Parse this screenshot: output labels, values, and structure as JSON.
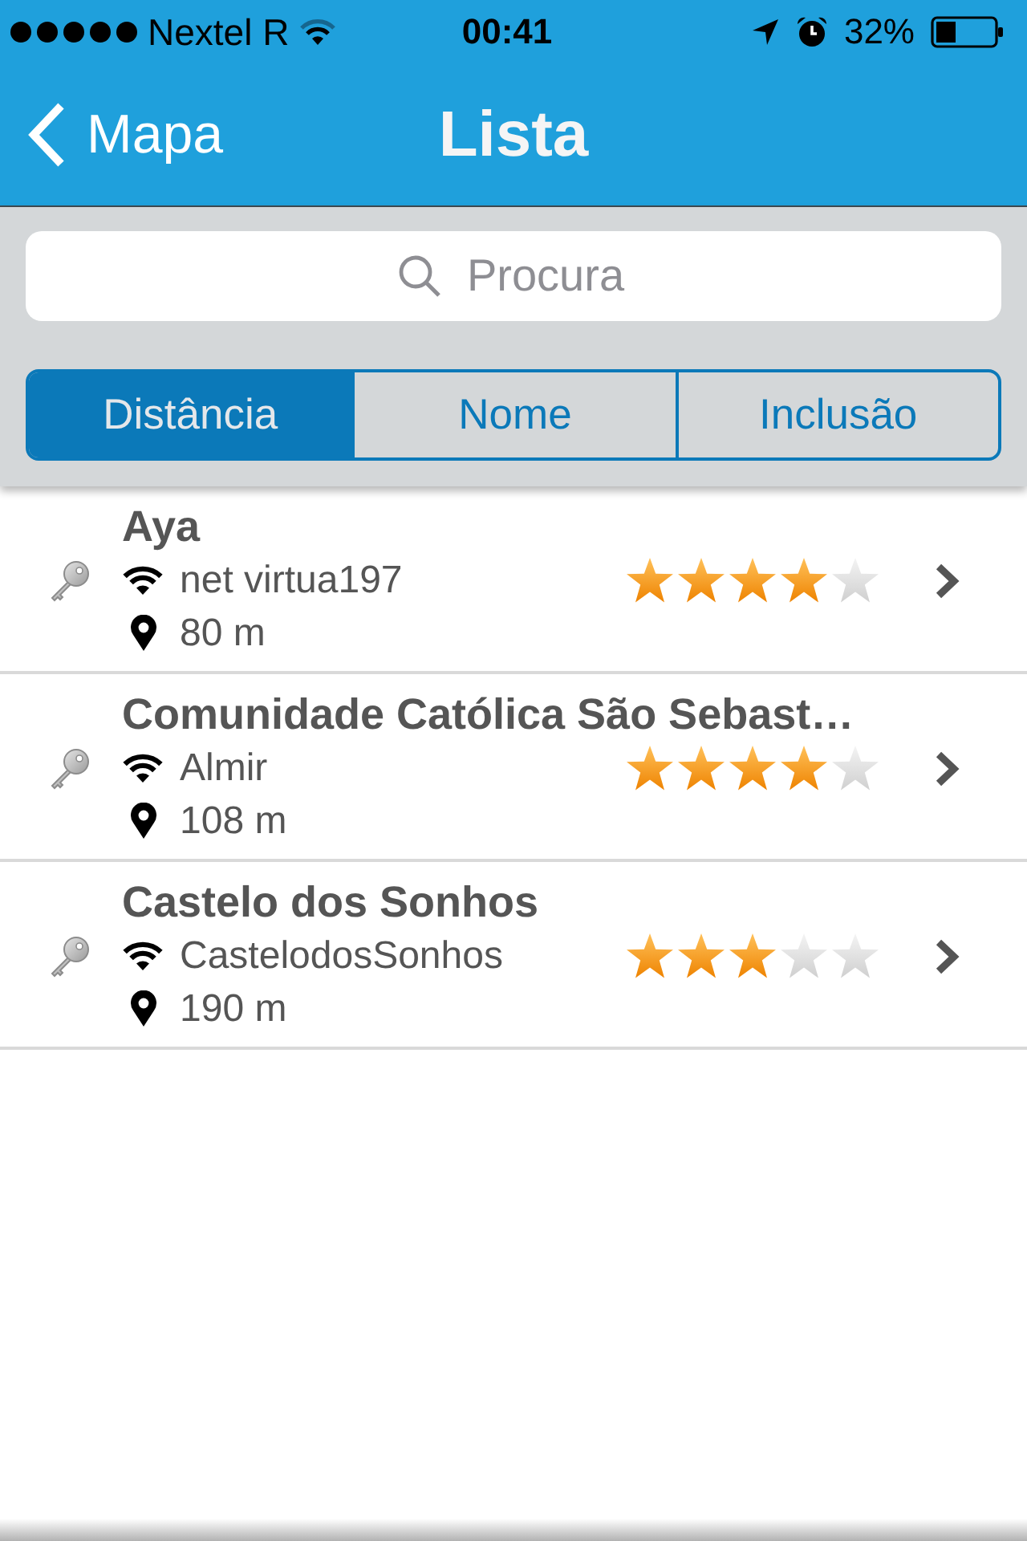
{
  "status_bar": {
    "carrier": "Nextel R",
    "time": "00:41",
    "battery": "32%"
  },
  "nav_bar": {
    "back": "Mapa",
    "title": "Lista"
  },
  "search": {
    "placeholder": "Procura"
  },
  "sort_tabs": [
    {
      "label": "Distância",
      "selected": true
    },
    {
      "label": "Nome",
      "selected": false
    },
    {
      "label": "Inclusão",
      "selected": false
    }
  ],
  "networks": [
    {
      "name": "Aya",
      "ssid": "net virtua197",
      "distance": "80 m",
      "stars": 4
    },
    {
      "name": "Comunidade Católica São Sebast…",
      "ssid": "Almir",
      "distance": "108 m",
      "stars": 4
    },
    {
      "name": "Castelo dos Sonhos",
      "ssid": "CastelodosSonhos",
      "distance": "190 m",
      "stars": 3
    }
  ]
}
